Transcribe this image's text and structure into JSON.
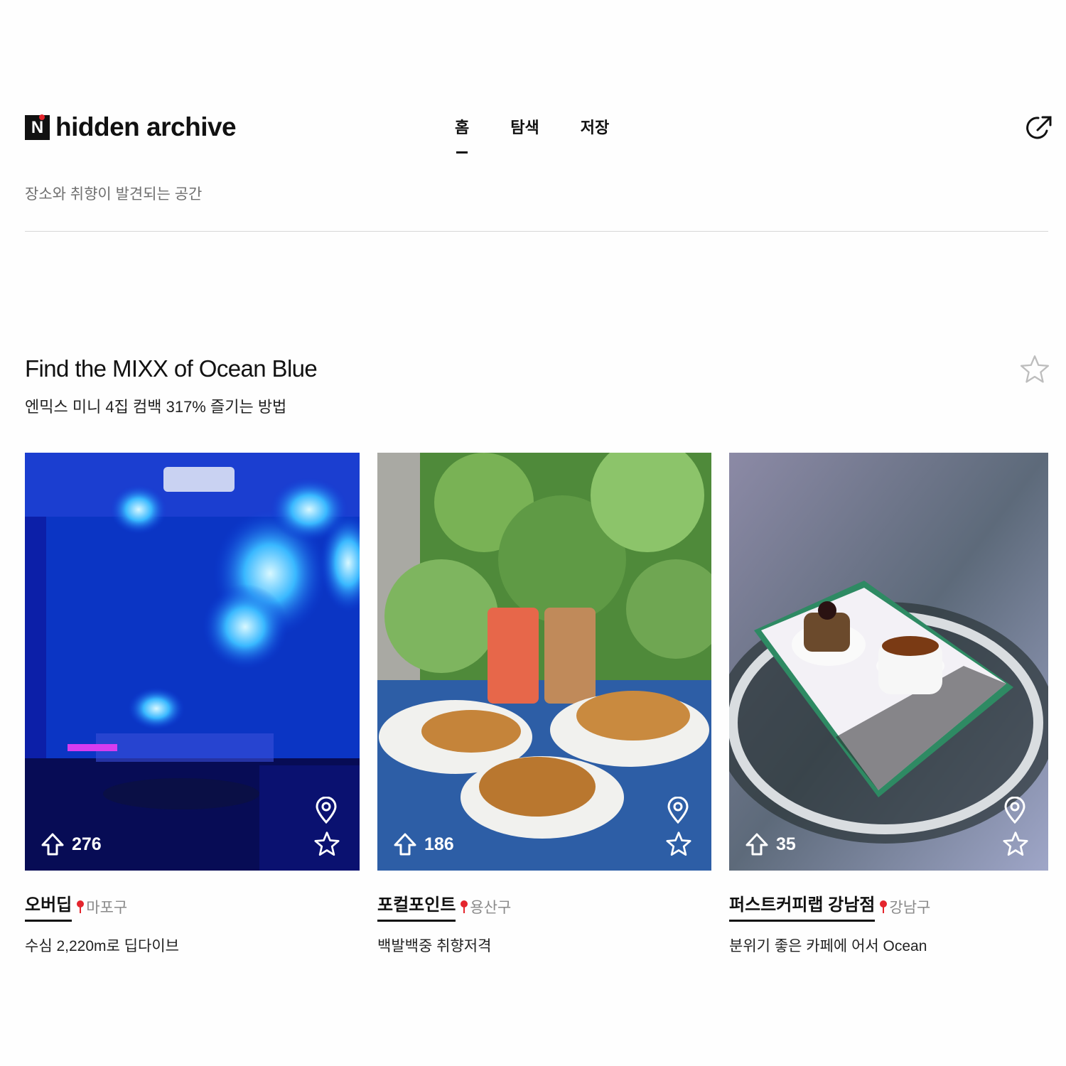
{
  "brand": {
    "badge": "N",
    "name": "hidden archive",
    "accent": "#e4252d"
  },
  "nav": {
    "items": [
      {
        "label": "홈",
        "active": true
      },
      {
        "label": "탐색",
        "active": false
      },
      {
        "label": "저장",
        "active": false
      }
    ]
  },
  "header": {
    "tagline": "장소와 취향이 발견되는 공간",
    "share_icon": "share-icon"
  },
  "section": {
    "title": "Find the MIXX of Ocean Blue",
    "subtitle": "엔믹스 미니 4집 컴백 317% 즐기는 방법"
  },
  "cards": [
    {
      "name": "오버딥",
      "district": "마포구",
      "description": "수심 2,220m로 딥다이브",
      "upvotes": "276",
      "image": "jellyfish aquarium"
    },
    {
      "name": "포컬포인트",
      "district": "용산구",
      "description": "백발백중 취향저격",
      "upvotes": "186",
      "image": "pastries and drinks"
    },
    {
      "name": "퍼스트커피랩 강남점",
      "district": "강남구",
      "description": "분위기 좋은 카페에 어서 Ocean",
      "upvotes": "35",
      "image": "coffee on glass table"
    }
  ]
}
